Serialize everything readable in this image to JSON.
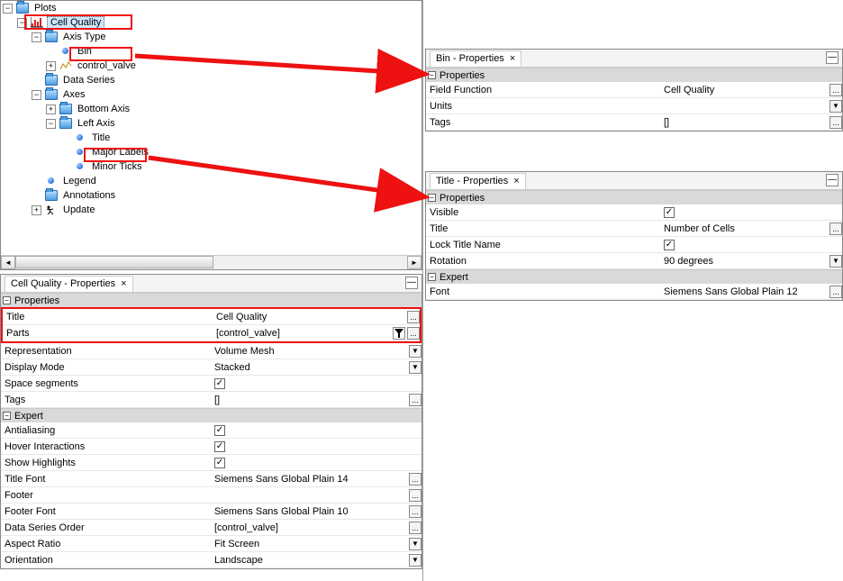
{
  "tree": {
    "root": "Plots",
    "cellQuality": "Cell Quality",
    "axisType": "Axis Type",
    "bin": "Bin",
    "controlValve": "control_valve",
    "dataSeries": "Data Series",
    "axes": "Axes",
    "bottomAxis": "Bottom Axis",
    "leftAxis": "Left Axis",
    "title": "Title",
    "majorLabels": "Major Labels",
    "minorTicks": "Minor Ticks",
    "legend": "Legend",
    "annotations": "Annotations",
    "update": "Update"
  },
  "cellQualityPanel": {
    "tab": "Cell Quality - Properties",
    "grpProperties": "Properties",
    "grpExpert": "Expert",
    "title_l": "Title",
    "title_v": "Cell Quality",
    "parts_l": "Parts",
    "parts_v": "[control_valve]",
    "rep_l": "Representation",
    "rep_v": "Volume Mesh",
    "disp_l": "Display Mode",
    "disp_v": "Stacked",
    "space_l": "Space segments",
    "tags_l": "Tags",
    "tags_v": "[]",
    "aa_l": "Antialiasing",
    "hover_l": "Hover Interactions",
    "show_l": "Show Highlights",
    "tfont_l": "Title Font",
    "tfont_v": "Siemens Sans Global Plain 14",
    "footer_l": "Footer",
    "footer_v": "",
    "ffont_l": "Footer Font",
    "ffont_v": "Siemens Sans Global Plain 10",
    "dso_l": "Data Series Order",
    "dso_v": "[control_valve]",
    "ar_l": "Aspect Ratio",
    "ar_v": "Fit Screen",
    "orient_l": "Orientation",
    "orient_v": "Landscape"
  },
  "binPanel": {
    "tab": "Bin - Properties",
    "grpProperties": "Properties",
    "ff_l": "Field Function",
    "ff_v": "Cell Quality",
    "units_l": "Units",
    "units_v": "",
    "tags_l": "Tags",
    "tags_v": "[]"
  },
  "titlePanel": {
    "tab": "Title - Properties",
    "grpProperties": "Properties",
    "grpExpert": "Expert",
    "vis_l": "Visible",
    "title_l": "Title",
    "title_v": "Number of Cells",
    "lock_l": "Lock Title Name",
    "rot_l": "Rotation",
    "rot_v": "90 degrees",
    "font_l": "Font",
    "font_v": "Siemens Sans Global Plain 12"
  },
  "glyph": {
    "ell": "...",
    "dd": "▼",
    "minus": "−",
    "plus": "+",
    "check": "✓",
    "close": "×",
    "min": "—",
    "left": "◄",
    "right": "►"
  }
}
